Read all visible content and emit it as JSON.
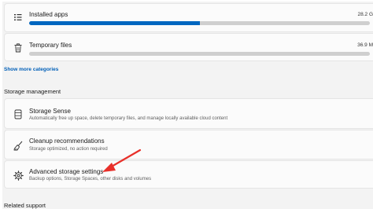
{
  "storage_usage": {
    "installed_apps": {
      "label": "Installed apps",
      "size": "28.2 G",
      "usage_fraction": 0.5,
      "bar_color": "#0067c0"
    },
    "temporary_files": {
      "label": "Temporary files",
      "size": "36.9 M",
      "usage_fraction": 0.0,
      "bar_color": "#0067c0"
    },
    "show_more_label": "Show more categories"
  },
  "storage_management": {
    "heading": "Storage management",
    "items": [
      {
        "title": "Storage Sense",
        "description": "Automatically free up space, delete temporary files, and manage locally available cloud content",
        "icon": "storage-drive-icon"
      },
      {
        "title": "Cleanup recommendations",
        "description": "Storage optimized, no action required",
        "icon": "broom-icon"
      },
      {
        "title": "Advanced storage settings",
        "description": "Backup options, Storage Spaces, other disks and volumes",
        "icon": "gear-icon"
      }
    ]
  },
  "related": {
    "heading": "Related support"
  },
  "annotation": {
    "arrow_color": "#e8302a"
  }
}
